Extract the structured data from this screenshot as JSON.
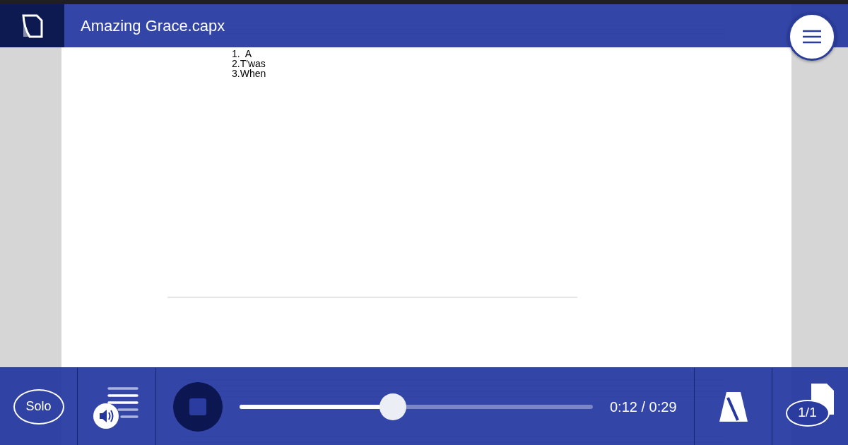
{
  "header": {
    "title": "Amazing Grace.capx"
  },
  "score": {
    "verse_labels": [
      "1.  A",
      "2.T'was",
      "3.When"
    ]
  },
  "controls": {
    "solo_label": "Solo",
    "playing": true,
    "progress": {
      "level": 0.434
    },
    "time": "0:12 / 0:29",
    "page_indicator": "1/1"
  }
}
